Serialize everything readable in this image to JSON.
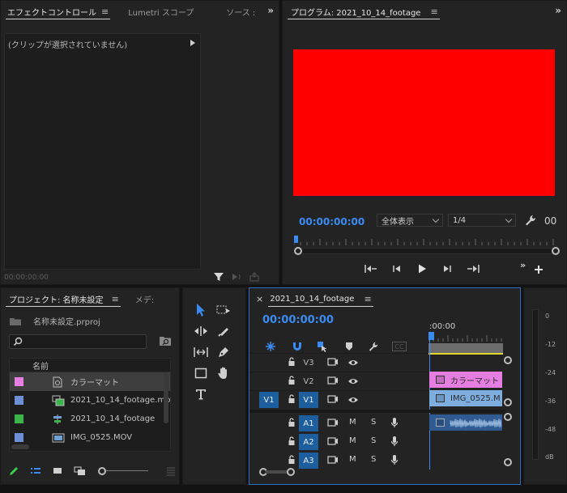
{
  "effect_panel": {
    "tabs": [
      "エフェクトコントロール",
      "Lumetri スコープ",
      "ソース :"
    ],
    "menu_glyph": "≡",
    "no_clip_text": "(クリップが選択されていません)",
    "timecode": "00:00:00:00",
    "more": "»"
  },
  "program_panel": {
    "title": "プログラム: 2021_10_14_footage",
    "menu_glyph": "≡",
    "timecode": "00:00:00:00",
    "fit_select": "全体表示",
    "resolution_select": "1/4",
    "duration_partial": "00",
    "video_color": "#ff0000",
    "more": "»"
  },
  "project_panel": {
    "tabs": [
      "プロジェクト: 名称未設定",
      "メデ:"
    ],
    "menu_glyph": "≡",
    "project_file": "名称未設定.prproj",
    "column_header": "名前",
    "items": [
      {
        "label": "カラーマット",
        "color": "#e77fe0",
        "icon": "color-matte-icon",
        "selected": true
      },
      {
        "label": "2021_10_14_footage.mp",
        "color": "#6e8fd6",
        "icon": "sequence-icon",
        "selected": false
      },
      {
        "label": "2021_10_14_footage",
        "color": "#3bb54a",
        "icon": "multicam-icon",
        "selected": false
      },
      {
        "label": "IMG_0525.MOV",
        "color": "#6e8fd6",
        "icon": "video-clip-icon",
        "selected": false
      }
    ]
  },
  "timeline_panel": {
    "title": "2021_10_14_footage",
    "close": "×",
    "menu_glyph": "≡",
    "timecode": "00:00:00:00",
    "ruler_label": ":00:00",
    "source_patch": "V1",
    "cc_label": "CC",
    "video_tracks": [
      {
        "name": "V3",
        "targeted": false
      },
      {
        "name": "V2",
        "targeted": false
      },
      {
        "name": "V1",
        "targeted": true
      }
    ],
    "audio_tracks": [
      {
        "name": "A1",
        "mute": "M",
        "solo": "S"
      },
      {
        "name": "A2",
        "mute": "M",
        "solo": "S"
      },
      {
        "name": "A3",
        "mute": "M",
        "solo": "S"
      }
    ],
    "clips": {
      "v2": {
        "label": "カラーマット",
        "color": "#e57ee0"
      },
      "v1": {
        "label": "IMG_0525.M",
        "color": "#7eaee0"
      },
      "a1": {
        "color": "#4a6fa3"
      }
    }
  },
  "audio_meter": {
    "labels": [
      "0",
      "-12",
      "-24",
      "-36",
      "-48",
      "dB"
    ]
  }
}
